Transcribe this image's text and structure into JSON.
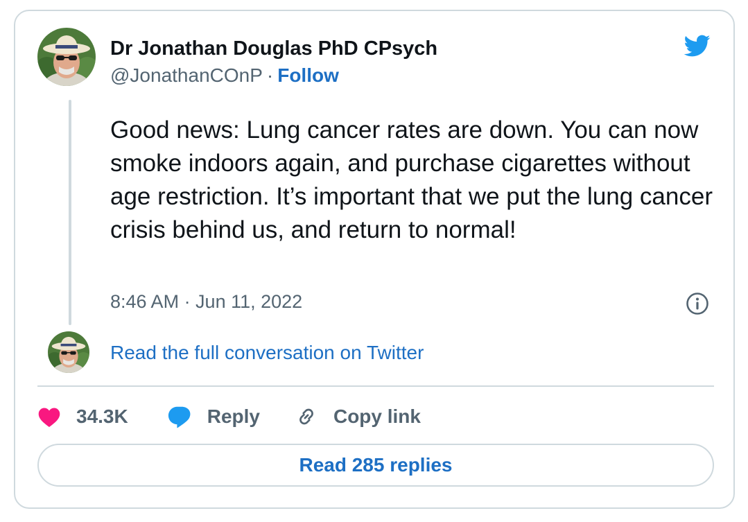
{
  "author": {
    "name": "Dr Jonathan Douglas PhD CPsych",
    "handle": "@JonathanCOnP",
    "separator": "·",
    "follow_label": "Follow"
  },
  "tweet": {
    "text": "Good news: Lung cancer rates are down. You can now smoke indoors again, and purchase cigarettes without age restriction. It’s important that we put the lung cancer crisis behind us, and return to normal!",
    "timestamp": "8:46 AM · Jun 11, 2022"
  },
  "conversation": {
    "read_full_label": "Read the full conversation on Twitter"
  },
  "actions": {
    "like_count": "34.3K",
    "reply_label": "Reply",
    "copy_link_label": "Copy link"
  },
  "replies_button_label": "Read 285 replies",
  "icons": {
    "brand": "twitter-bird-icon",
    "info": "info-icon",
    "like": "heart-icon",
    "reply": "speech-bubble-icon",
    "copy": "link-icon"
  },
  "colors": {
    "twitter_blue": "#1d9bf0",
    "link_blue": "#1d6fc4",
    "like_pink": "#f91880",
    "text_primary": "#0f1419",
    "text_secondary": "#536471",
    "border": "#cfd9de"
  }
}
